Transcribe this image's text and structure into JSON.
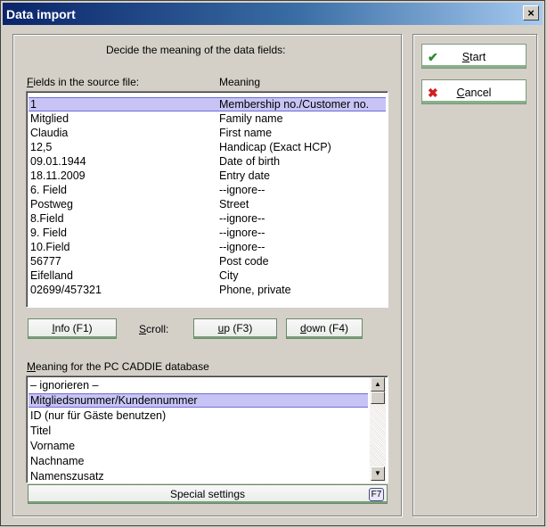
{
  "window": {
    "title": "Data import",
    "close_glyph": "×"
  },
  "main": {
    "instruction": "Decide the meaning of the data fields:",
    "source_header_prefix": "F",
    "source_header_rest": "ields in the source file:",
    "meaning_header": "Meaning",
    "fields": [
      {
        "source": "1",
        "meaning": "Membership no./Customer no.",
        "selected": true
      },
      {
        "source": "Mitglied",
        "meaning": "Family name"
      },
      {
        "source": " Claudia",
        "meaning": "First name"
      },
      {
        "source": "12,5",
        "meaning": "Handicap (Exact HCP)"
      },
      {
        "source": "09.01.1944",
        "meaning": "Date of birth"
      },
      {
        "source": "18.11.2009",
        "meaning": "Entry date"
      },
      {
        "source": " 6. Field",
        "meaning": "--ignore--"
      },
      {
        "source": "Postweg",
        "meaning": "Street"
      },
      {
        "source": " 8.Field",
        "meaning": "--ignore--"
      },
      {
        "source": " 9. Field",
        "meaning": "--ignore--"
      },
      {
        "source": " 10.Field",
        "meaning": "--ignore--"
      },
      {
        "source": "56777",
        "meaning": "Post code"
      },
      {
        "source": "Eifelland",
        "meaning": "City"
      },
      {
        "source": "02699/457321",
        "meaning": "Phone, private"
      }
    ],
    "info_prefix": "I",
    "info_rest": "nfo (F1)",
    "scroll_prefix": "S",
    "scroll_rest": "croll:",
    "up_prefix": "u",
    "up_rest": "p (F3)",
    "down_prefix": "d",
    "down_rest": "own (F4)",
    "db_header_prefix": "M",
    "db_header_rest": "eaning for the PC CADDIE database",
    "db_options": [
      {
        "label": "– ignorieren –"
      },
      {
        "label": "Mitgliedsnummer/Kundennummer",
        "selected": true
      },
      {
        "label": "ID (nur für Gäste benutzen)"
      },
      {
        "label": "Titel"
      },
      {
        "label": "Vorname"
      },
      {
        "label": "Nachname"
      },
      {
        "label": "Namenszusatz"
      }
    ],
    "special_label": "Special settings",
    "special_key": "F7"
  },
  "side": {
    "start_prefix": "S",
    "start_rest": "tart",
    "start_icon": "✔",
    "cancel_prefix": "C",
    "cancel_rest": "ancel",
    "cancel_icon": "✖",
    "start_color": "#2a8a2a",
    "cancel_color": "#d02020"
  }
}
